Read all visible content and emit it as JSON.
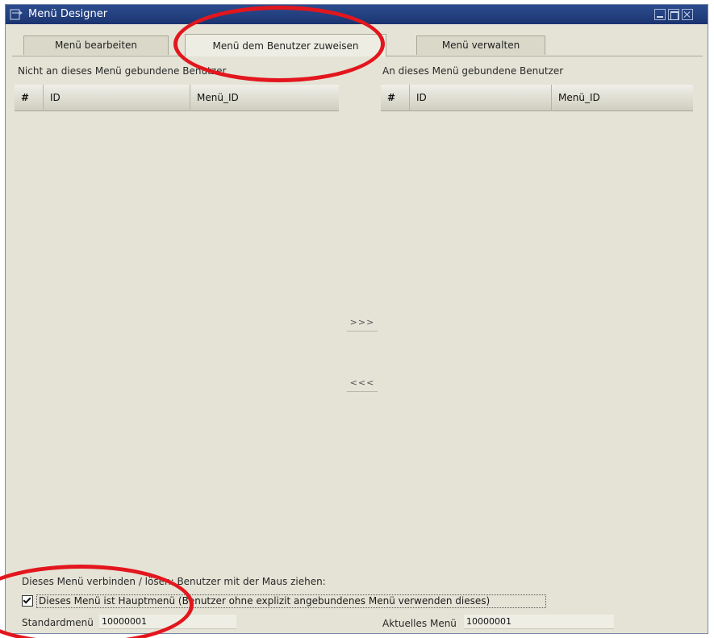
{
  "window": {
    "title": "Menü Designer"
  },
  "tabs": [
    {
      "label": "Menü bearbeiten"
    },
    {
      "label": "Menü dem Benutzer zuweisen"
    },
    {
      "label": "Menü verwalten"
    }
  ],
  "left_panel": {
    "label": "Nicht an dieses Menü gebundene Benutzer",
    "columns": [
      "#",
      "ID",
      "Menü_ID"
    ]
  },
  "right_panel": {
    "label": "An dieses Menü gebundene Benutzer",
    "columns": [
      "#",
      "ID",
      "Menü_ID"
    ]
  },
  "move_buttons": {
    "add": ">>>",
    "remove": "<<<"
  },
  "hint": "Dieses Menü verbinden / lösen: Benutzer mit der Maus ziehen:",
  "main_menu_checkbox": {
    "label": "Dieses Menü ist Hauptmenü (Benutzer ohne explizit angebundenes Menü verwenden dieses)",
    "checked": true
  },
  "standard_menu": {
    "label": "Standardmenü",
    "value": "10000001"
  },
  "current_menu": {
    "label": "Aktuelles Menü",
    "value": "10000001"
  },
  "colors": {
    "annotation": "#e3161d",
    "titlebar": "#1b3470",
    "panel": "#e4e3d6"
  }
}
